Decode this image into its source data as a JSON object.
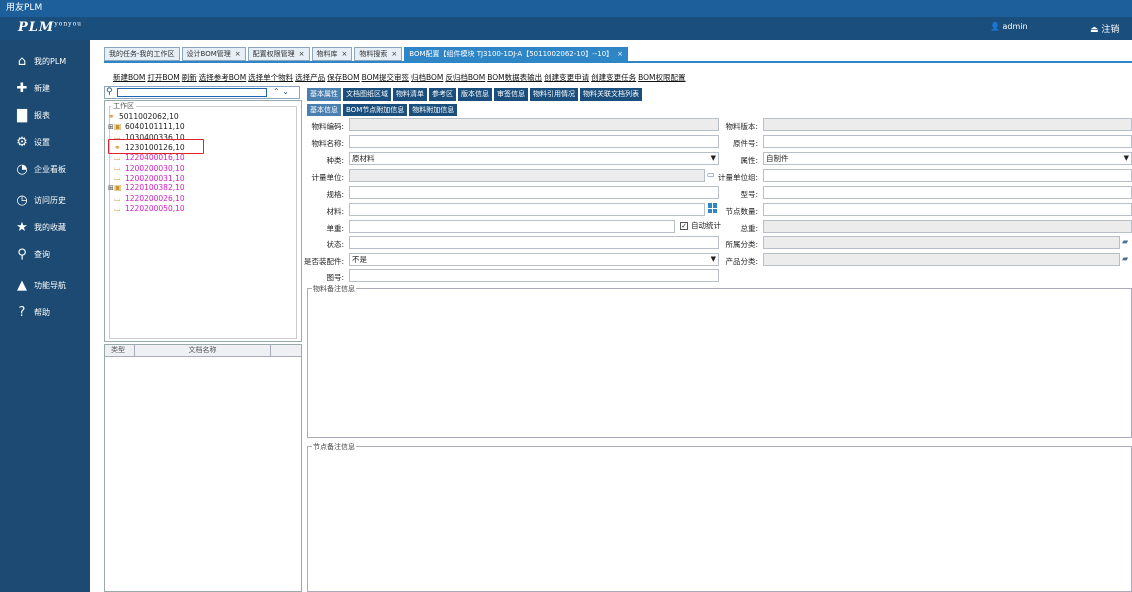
{
  "window": {
    "title": "用友PLM"
  },
  "header": {
    "logo": "PLM",
    "logo_sup": "yonyou",
    "user": "admin",
    "logout": "注销"
  },
  "sidenav": [
    {
      "label": "我的PLM",
      "icon": "home-icon",
      "glyph": "⌂"
    },
    {
      "label": "新建",
      "icon": "add-icon",
      "glyph": "✚"
    },
    {
      "label": "报表",
      "icon": "chart-icon",
      "glyph": "▇"
    },
    {
      "label": "设置",
      "icon": "gear-icon",
      "glyph": "⚙"
    },
    {
      "label": "企业看板",
      "icon": "dashboard-icon",
      "glyph": "◔"
    },
    {
      "label": "访问历史",
      "icon": "clock-icon",
      "glyph": "◷"
    },
    {
      "label": "我的收藏",
      "icon": "star-icon",
      "glyph": "★"
    },
    {
      "label": "查询",
      "icon": "search-icon",
      "glyph": "⚲"
    },
    {
      "label": "功能导航",
      "icon": "navigation-icon",
      "glyph": "▲"
    },
    {
      "label": "帮助",
      "icon": "help-icon",
      "glyph": "?"
    }
  ],
  "tabs": [
    {
      "label": "我的任务-我的工作区",
      "closable": false
    },
    {
      "label": "设计BOM管理",
      "closable": true
    },
    {
      "label": "配置权限管理",
      "closable": true
    },
    {
      "label": "物料库",
      "closable": true
    },
    {
      "label": "物料搜索",
      "closable": true
    },
    {
      "label": "BOM配置【组件模块 TJ3100-1DJ-A【5011002062-10】--10】",
      "closable": true,
      "active": true
    }
  ],
  "toolbar": [
    "新建BOM",
    "打开BOM",
    "刷新",
    "选择参考BOM",
    "选择单个物料",
    "选择产品",
    "保存BOM",
    "BOM提交审签",
    "归档BOM",
    "反归档BOM",
    "BOM数据表输出",
    "创建变更申请",
    "创建变更任务",
    "BOM权限配置"
  ],
  "tree": {
    "legend": "工作区",
    "nodes": [
      {
        "label": "5011002062,10",
        "level": 0,
        "expander": "",
        "pink": false
      },
      {
        "label": "6040101111,10",
        "level": 1,
        "expander": "⊞",
        "pink": false
      },
      {
        "label": "1030400336,10",
        "level": 1,
        "expander": "",
        "pink": false
      },
      {
        "label": "1230100126,10",
        "level": 1,
        "expander": "",
        "pink": false
      },
      {
        "label": "1220400016,10",
        "level": 1,
        "expander": "",
        "pink": true
      },
      {
        "label": "1200200030,10",
        "level": 1,
        "expander": "",
        "pink": true
      },
      {
        "label": "1200200031,10",
        "level": 1,
        "expander": "",
        "pink": true
      },
      {
        "label": "1220100382,10",
        "level": 1,
        "expander": "⊞",
        "pink": true
      },
      {
        "label": "1220200026,10",
        "level": 1,
        "expander": "",
        "pink": true
      },
      {
        "label": "1220200050,10",
        "level": 1,
        "expander": "",
        "pink": true
      }
    ]
  },
  "docpanel": {
    "headers": [
      "类型",
      "文档名称"
    ]
  },
  "subtabs": [
    "基本属性",
    "文档图纸区域",
    "物料清单",
    "参考区",
    "版本信息",
    "审签信息",
    "物料引用情况",
    "物料关联文档列表"
  ],
  "subtabs2": [
    "基本信息",
    "BOM节点附加信息",
    "物料附加信息"
  ],
  "form": {
    "code_label": "物料编码:",
    "code_value": "",
    "name_label": "物料名称:",
    "name_value": "",
    "kind_label": "种类:",
    "kind_value": "原材料",
    "unit_label": "计量单位:",
    "unit_value": "",
    "spec_label": "规格:",
    "spec_value": "",
    "material_label": "材料:",
    "material_value": "",
    "weight_label": "单重:",
    "weight_value": "",
    "autocalc_label": "自动统计",
    "status_label": "状态:",
    "status_value": "",
    "assemble_label": "是否装配件:",
    "assemble_value": "不是",
    "drawing_label": "图号:",
    "drawing_value": "",
    "version_label": "物料版本:",
    "version_value": "",
    "origin_label": "原件号:",
    "origin_value": "",
    "attr_label": "属性:",
    "attr_value": "自制件",
    "unitgroup_label": "计量单位组:",
    "unitgroup_value": "",
    "model_label": "型号:",
    "model_value": "",
    "nodecount_label": "节点数量:",
    "nodecount_value": "",
    "totalweight_label": "总重:",
    "totalweight_value": "",
    "category_label": "所属分类:",
    "category_value": "",
    "prodcategory_label": "产品分类:",
    "prodcategory_value": ""
  },
  "notes": {
    "material_note": "物料备注信息",
    "node_note": "节点备注信息"
  }
}
